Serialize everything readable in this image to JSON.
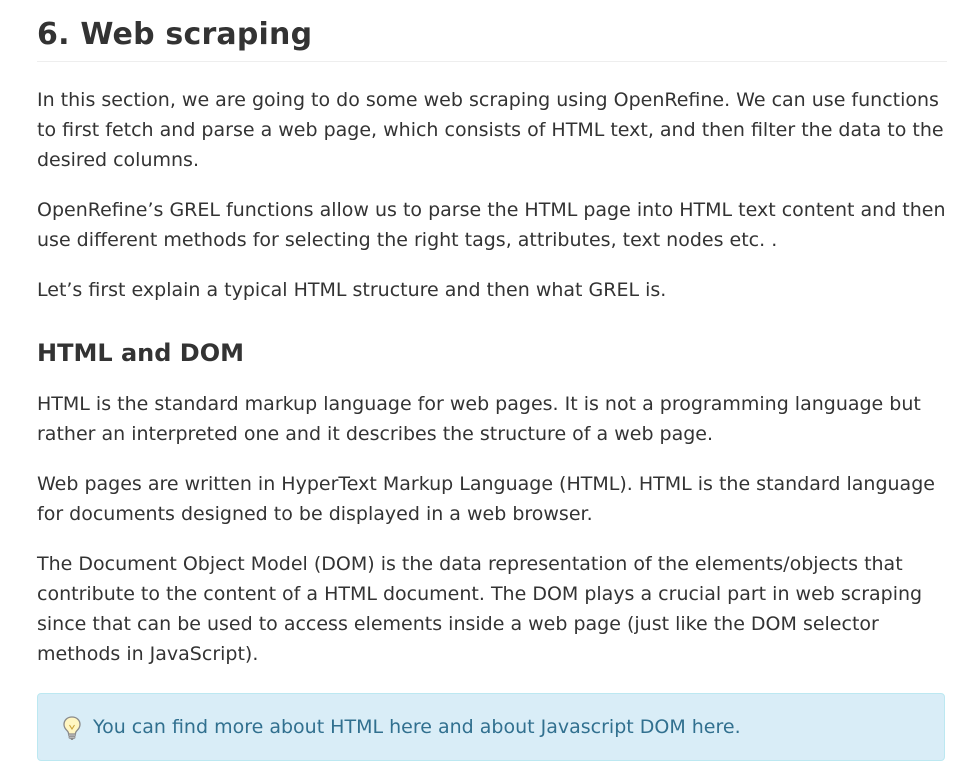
{
  "section": {
    "title": "6. Web scraping",
    "paragraphs": [
      "In this section, we are going to do some web scraping using OpenRefine. We can use functions to first fetch and parse a web page, which consists of HTML text, and then filter the data to the desired columns.",
      "OpenRefine’s GREL functions allow us to parse the HTML page into HTML text content and then use different methods for selecting the right tags, attributes, text nodes etc. .",
      "Let’s first explain a typical HTML structure and then what GREL is."
    ]
  },
  "subsection": {
    "title": "HTML and DOM",
    "paragraphs": [
      "HTML is the standard markup language for web pages. It is not a programming language but rather an interpreted one and it describes the structure of a web page.",
      "Web pages are written in HyperText Markup Language (HTML). HTML is the standard language for documents designed to be displayed in a web browser.",
      "The Document Object Model (DOM) is the data representation of the elements/objects that contribute to the content of a HTML document. The DOM plays a crucial part in web scraping since that can be used to access elements inside a web page (just like the DOM selector methods in JavaScript)."
    ]
  },
  "tip": {
    "icon": "lightbulb-icon",
    "text_before": "You can find more about HTML ",
    "link1": "here",
    "text_middle": " and about Javascript DOM ",
    "link2": "here",
    "text_after": ".",
    "background_color": "#d9edf7",
    "text_color": "#31708f"
  }
}
